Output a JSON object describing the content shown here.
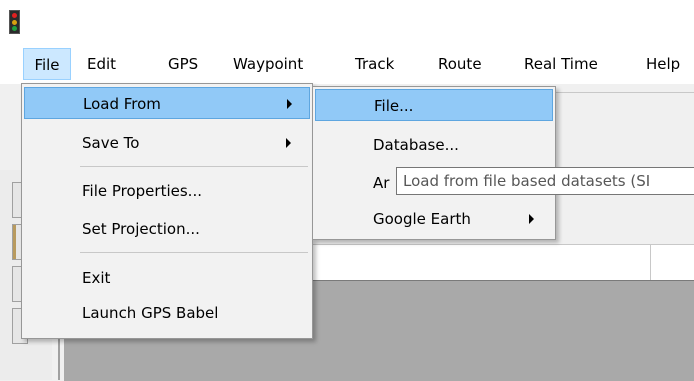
{
  "app": {
    "icon": "traffic-light-icon"
  },
  "menubar": {
    "items": [
      {
        "label": "File"
      },
      {
        "label": "Edit"
      },
      {
        "label": "GPS"
      },
      {
        "label": "Waypoint"
      },
      {
        "label": "Track"
      },
      {
        "label": "Route"
      },
      {
        "label": "Real Time"
      },
      {
        "label": "Help"
      }
    ]
  },
  "file_menu": {
    "items": [
      {
        "label": "Load From"
      },
      {
        "label": "Save To"
      },
      {
        "label": "File Properties..."
      },
      {
        "label": "Set Projection..."
      },
      {
        "label": "Exit"
      },
      {
        "label": "Launch GPS Babel"
      }
    ]
  },
  "load_from_menu": {
    "items": [
      {
        "label": "File..."
      },
      {
        "label": "Database..."
      },
      {
        "label": "Ar"
      },
      {
        "label": "Google Earth"
      }
    ]
  },
  "tooltip": {
    "text": "Load from file based datasets (SI"
  },
  "colors": {
    "highlight": "#91c9f7",
    "menu_active": "#cce8ff",
    "menu_background": "#f2f2f2",
    "viewport": "#a9a9a9"
  }
}
